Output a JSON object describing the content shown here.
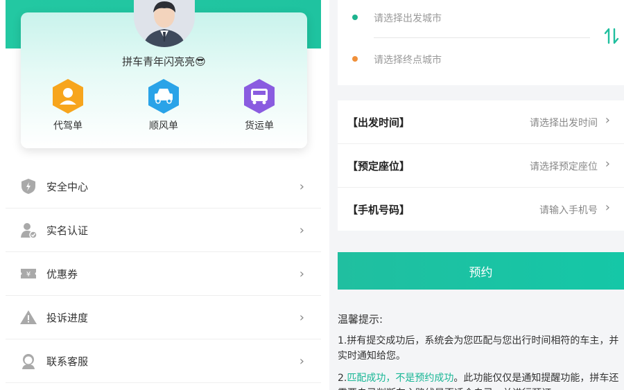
{
  "profile": {
    "username": "拼车青年闪亮亮😎",
    "order_types": [
      {
        "label": "代驾单",
        "icon": "driver-icon",
        "color": "#f6a21b"
      },
      {
        "label": "顺风单",
        "icon": "car-icon",
        "color": "#2aa3e8"
      },
      {
        "label": "货运单",
        "icon": "truck-icon",
        "color": "#8a5ce0"
      }
    ]
  },
  "menu": {
    "items": [
      {
        "label": "安全中心",
        "icon": "shield-icon"
      },
      {
        "label": "实名认证",
        "icon": "verified-user-icon"
      },
      {
        "label": "优惠券",
        "icon": "coupon-icon"
      },
      {
        "label": "投诉进度",
        "icon": "warning-icon"
      },
      {
        "label": "联系客服",
        "icon": "customer-service-icon"
      }
    ]
  },
  "route": {
    "departure_placeholder": "请选择出发城市",
    "destination_placeholder": "请选择终点城市",
    "departure_dot_color": "#1db38e",
    "destination_dot_color": "#f0903a"
  },
  "form": {
    "rows": [
      {
        "label": "【出发时间】",
        "value": "请选择出发时间"
      },
      {
        "label": "【预定座位】",
        "value": "请选择预定座位"
      },
      {
        "label": "【手机号码】",
        "value": "请输入手机号"
      }
    ]
  },
  "reserve_button": "预约",
  "tips": {
    "title": "温馨提示:",
    "p1": "1.拼有提交成功后，系统会为您匹配与您出行时间相符的车主，并实时通知给您。",
    "p2_prefix": "2.",
    "p2_highlight": "匹配成功，不是预约成功",
    "p2_rest": "。此功能仅仅是通知提醒功能，拼车还需要自己判断车主路线是否适合自己，并进行预订。"
  },
  "colors": {
    "accent": "#1fc3a0"
  }
}
